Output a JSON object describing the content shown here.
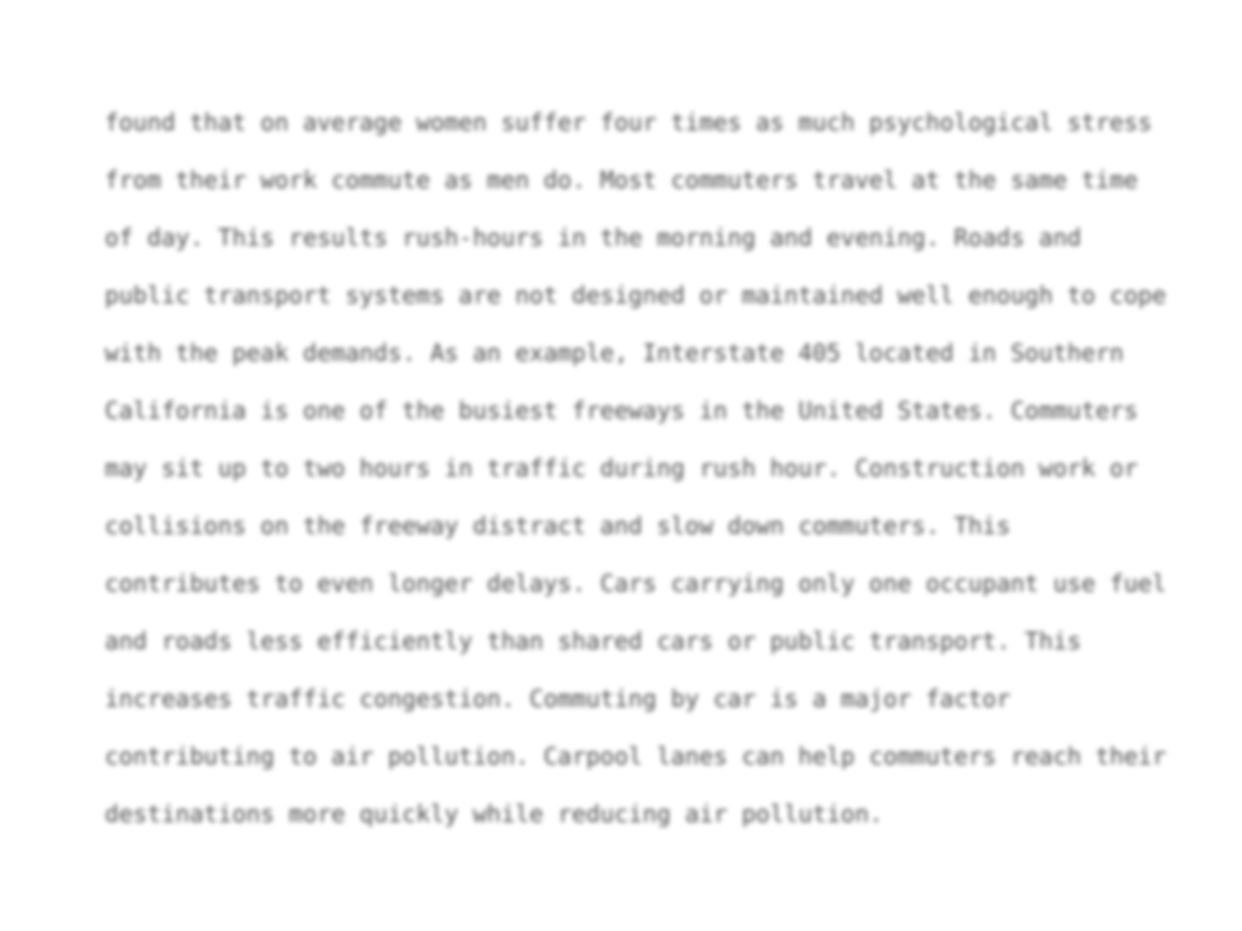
{
  "document": {
    "lines": [
      "found that on average women suffer four times as much psychological stress",
      "from their work commute as men do. Most commuters travel at the same time",
      "of day. This results rush-hours in the morning and evening. Roads and",
      "public transport systems are not designed or maintained well enough to cope",
      "with the peak demands. As an example, Interstate 405 located in Southern",
      "California is one of the busiest freeways in the United States. Commuters",
      "may sit up to two hours in traffic during rush hour. Construction work or",
      "collisions on the freeway distract and slow down commuters. This",
      "contributes to even longer delays. Cars carrying only one occupant use fuel",
      "and roads less efficiently than shared cars or public transport. This",
      "increases traffic congestion. Commuting by car is a major factor",
      "contributing to air pollution. Carpool lanes can help commuters reach their",
      "destinations more quickly while reducing air pollution."
    ]
  }
}
